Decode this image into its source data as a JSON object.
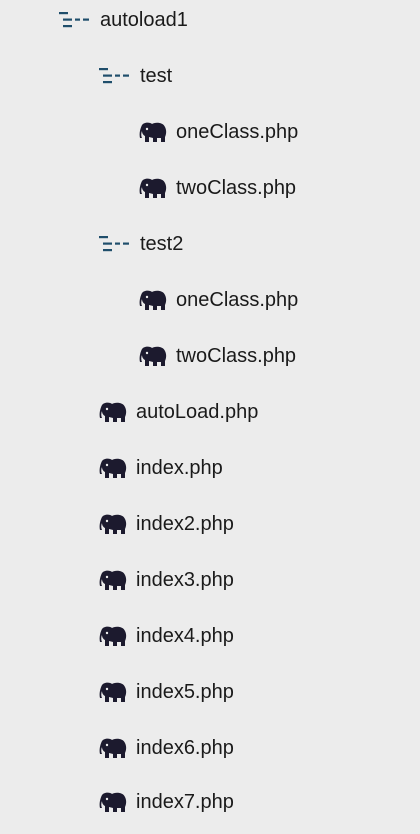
{
  "colors": {
    "background": "#ececec",
    "folder_icon": "#1f4e6b",
    "php_icon": "#1c1a2e"
  },
  "tree": [
    {
      "label": "autoload1",
      "icon": "folder-tree-icon",
      "depth": 0
    },
    {
      "label": "test",
      "icon": "folder-tree-icon",
      "depth": 1
    },
    {
      "label": "oneClass.php",
      "icon": "php-elephant-icon",
      "depth": 2
    },
    {
      "label": "twoClass.php",
      "icon": "php-elephant-icon",
      "depth": 2
    },
    {
      "label": "test2",
      "icon": "folder-tree-icon",
      "depth": 1
    },
    {
      "label": "oneClass.php",
      "icon": "php-elephant-icon",
      "depth": 2
    },
    {
      "label": "twoClass.php",
      "icon": "php-elephant-icon",
      "depth": 2
    },
    {
      "label": "autoLoad.php",
      "icon": "php-elephant-icon",
      "depth": 1
    },
    {
      "label": "index.php",
      "icon": "php-elephant-icon",
      "depth": 1
    },
    {
      "label": "index2.php",
      "icon": "php-elephant-icon",
      "depth": 1
    },
    {
      "label": "index3.php",
      "icon": "php-elephant-icon",
      "depth": 1
    },
    {
      "label": "index4.php",
      "icon": "php-elephant-icon",
      "depth": 1
    },
    {
      "label": "index5.php",
      "icon": "php-elephant-icon",
      "depth": 1
    },
    {
      "label": "index6.php",
      "icon": "php-elephant-icon",
      "depth": 1
    },
    {
      "label": "index7.php",
      "icon": "php-elephant-icon",
      "depth": 1
    }
  ]
}
